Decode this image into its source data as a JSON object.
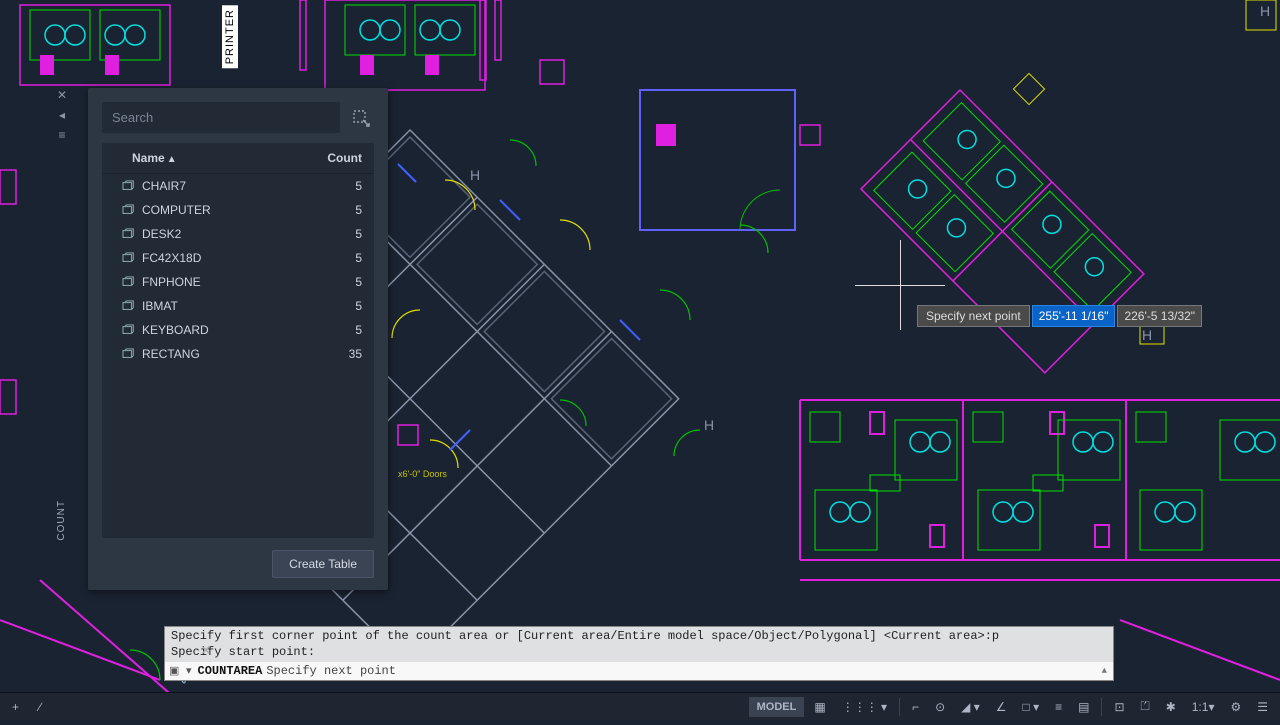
{
  "sidebar_label": "COUNT",
  "printer_label": "PRINTER",
  "palette": {
    "search_placeholder": "Search",
    "col_name": "Name",
    "col_count": "Count",
    "rows": [
      {
        "name": "CHAIR7",
        "count": "5"
      },
      {
        "name": "COMPUTER",
        "count": "5"
      },
      {
        "name": "DESK2",
        "count": "5"
      },
      {
        "name": "FC42X18D",
        "count": "5"
      },
      {
        "name": "FNPHONE",
        "count": "5"
      },
      {
        "name": "IBMAT",
        "count": "5"
      },
      {
        "name": "KEYBOARD",
        "count": "5"
      },
      {
        "name": "RECTANG",
        "count": "35"
      }
    ],
    "create_table": "Create Table"
  },
  "dyn_input": {
    "label": "Specify next point",
    "v1": "255'-11 1/16\"",
    "v2": "226'-5 13/32\""
  },
  "command": {
    "history_line1": "Specify first corner point of the count area or [Current area/Entire model space/Object/Polygonal] <Current area>:p",
    "history_line2": "Specify start point:",
    "active_cmd": "COUNTAREA",
    "active_prompt": "Specify next point"
  },
  "status": {
    "plus": "+",
    "model": "MODEL",
    "scale": "1:1",
    "gear": "⚙"
  },
  "doors": "x6'-0\"\nDoors"
}
